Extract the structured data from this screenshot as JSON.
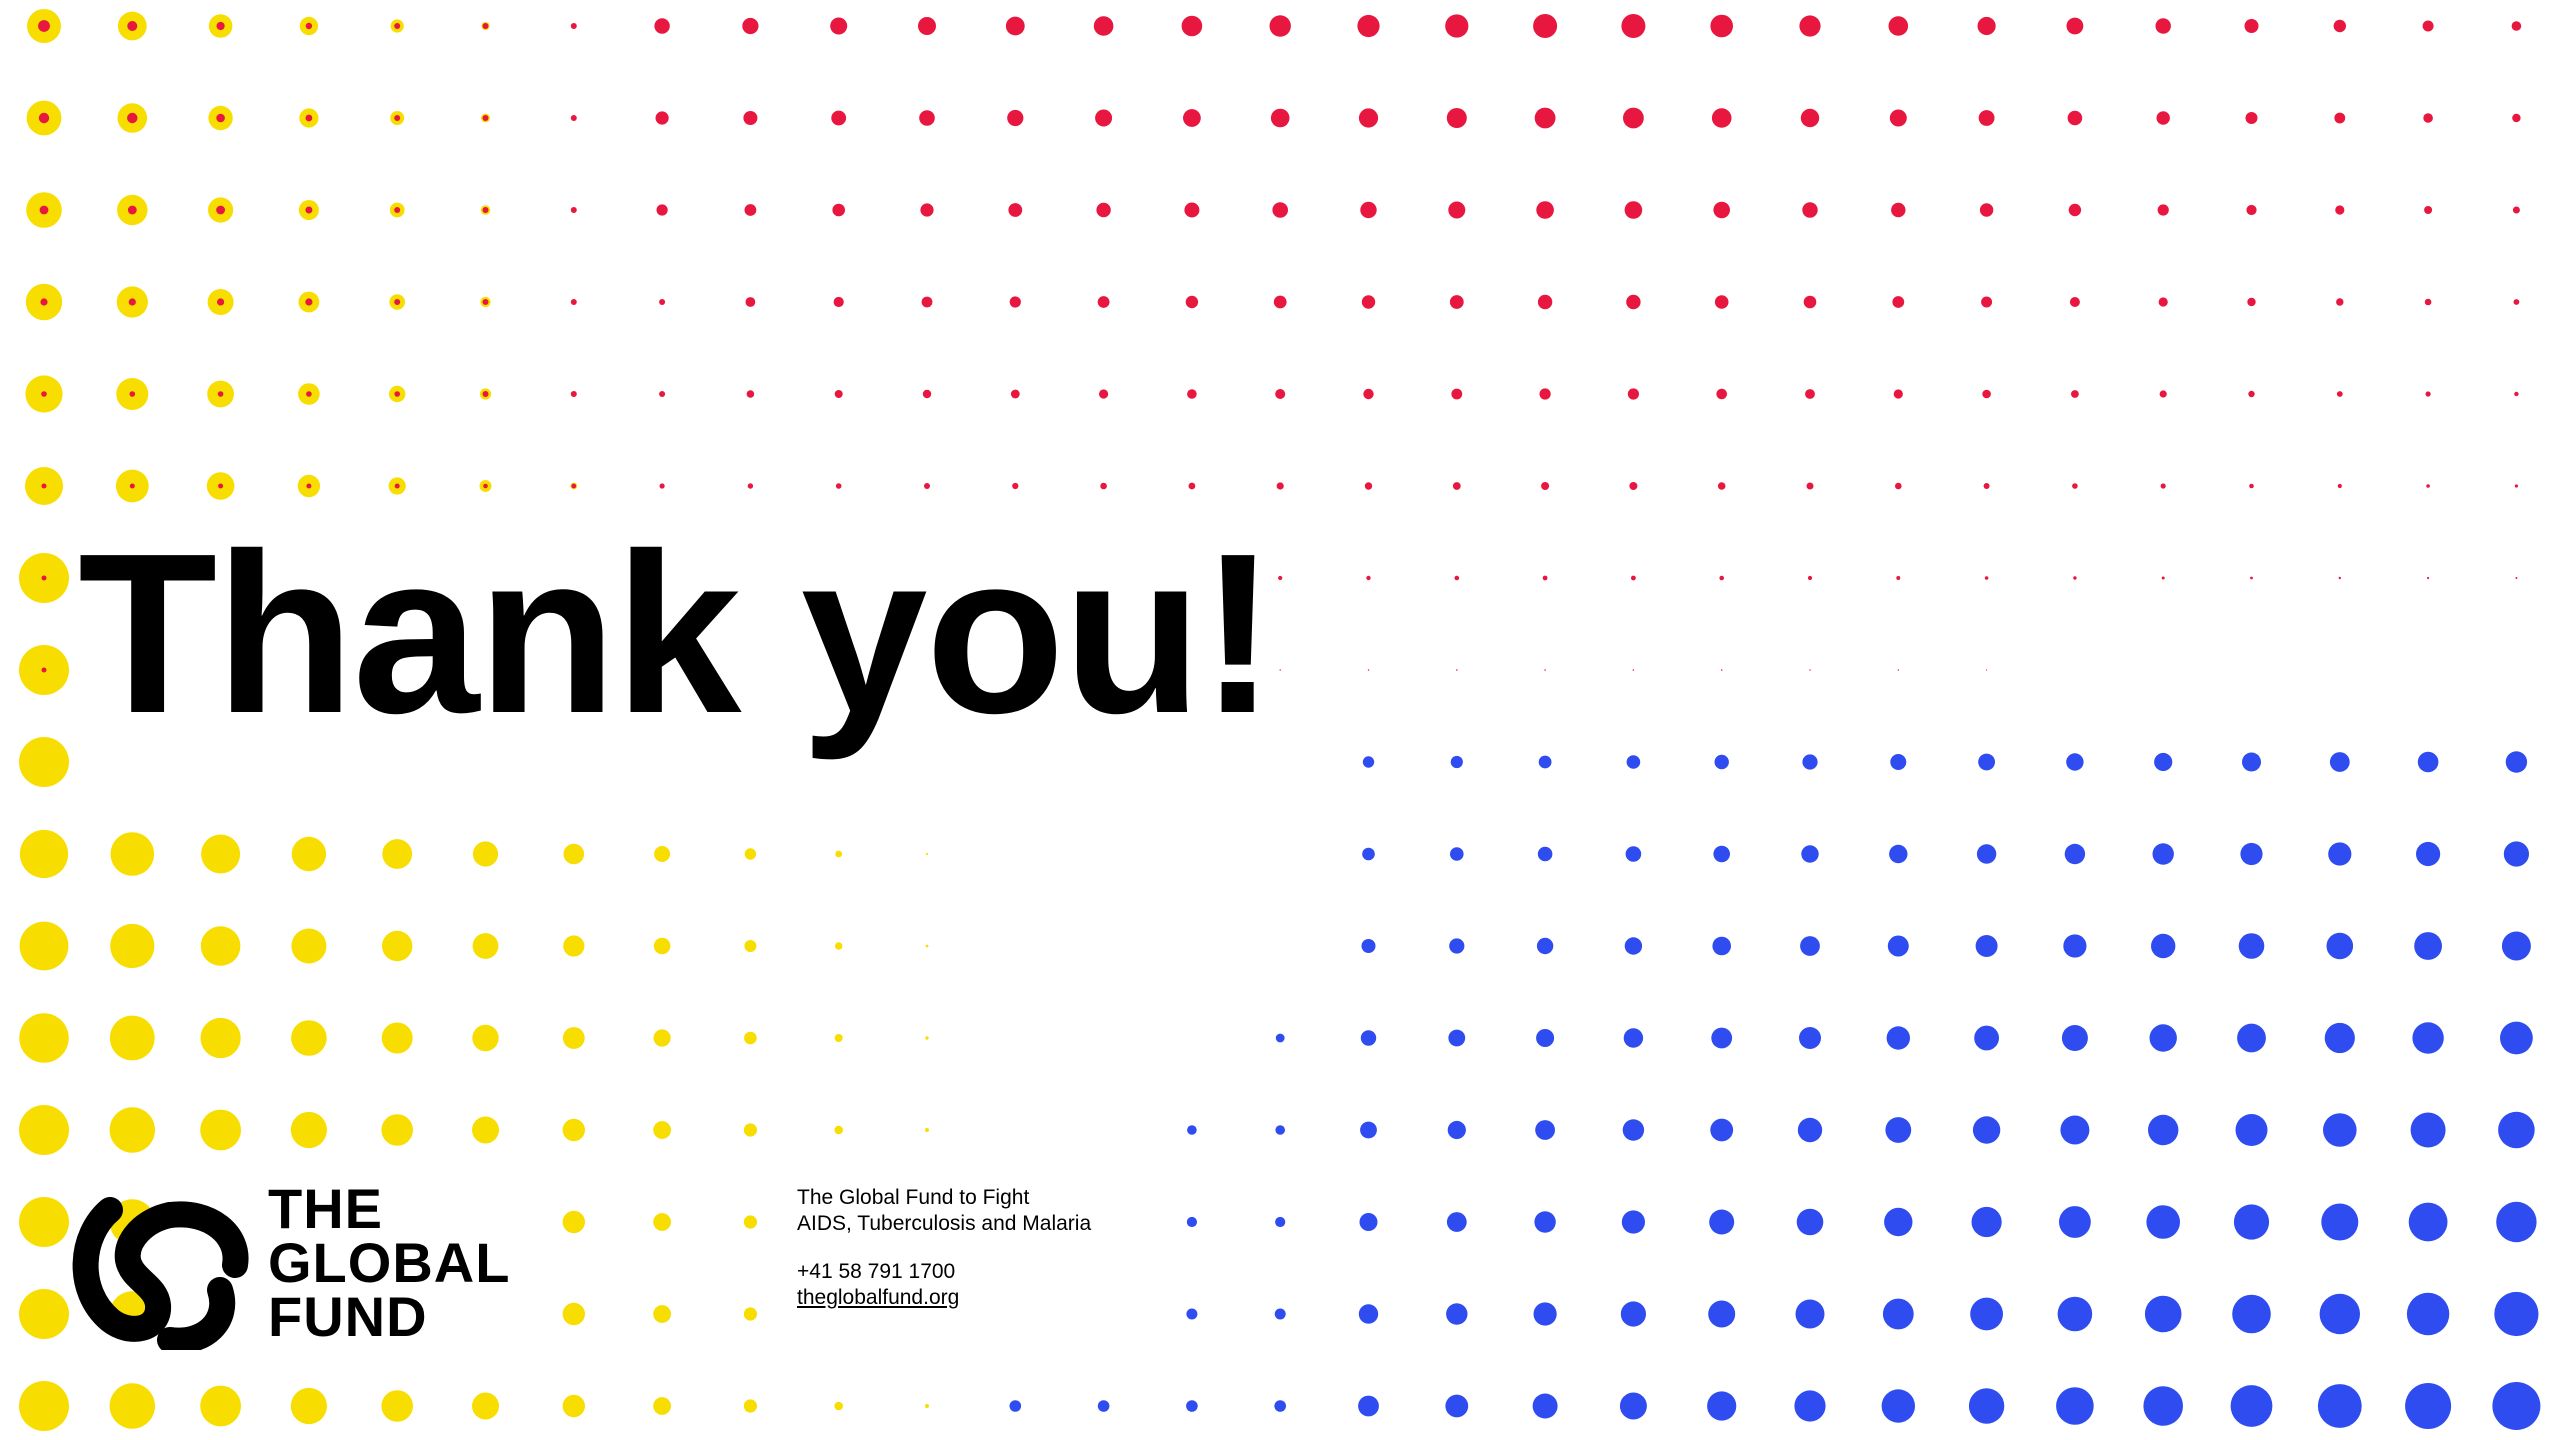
{
  "slide": {
    "title": "Thank you!"
  },
  "logo": {
    "icon": "global-fund-swirl-logo",
    "line1": "THE",
    "line2": "GLOBAL",
    "line3": "FUND"
  },
  "contact": {
    "org_line1": "The Global Fund to Fight",
    "org_line2": "AIDS, Tuberculosis and Malaria",
    "phone": "+41 58 791 1700",
    "website": "theglobalfund.org"
  },
  "colors": {
    "yellow": "#F7DE00",
    "red": "#E8173F",
    "blue": "#2E4CF0",
    "text": "#000000"
  }
}
